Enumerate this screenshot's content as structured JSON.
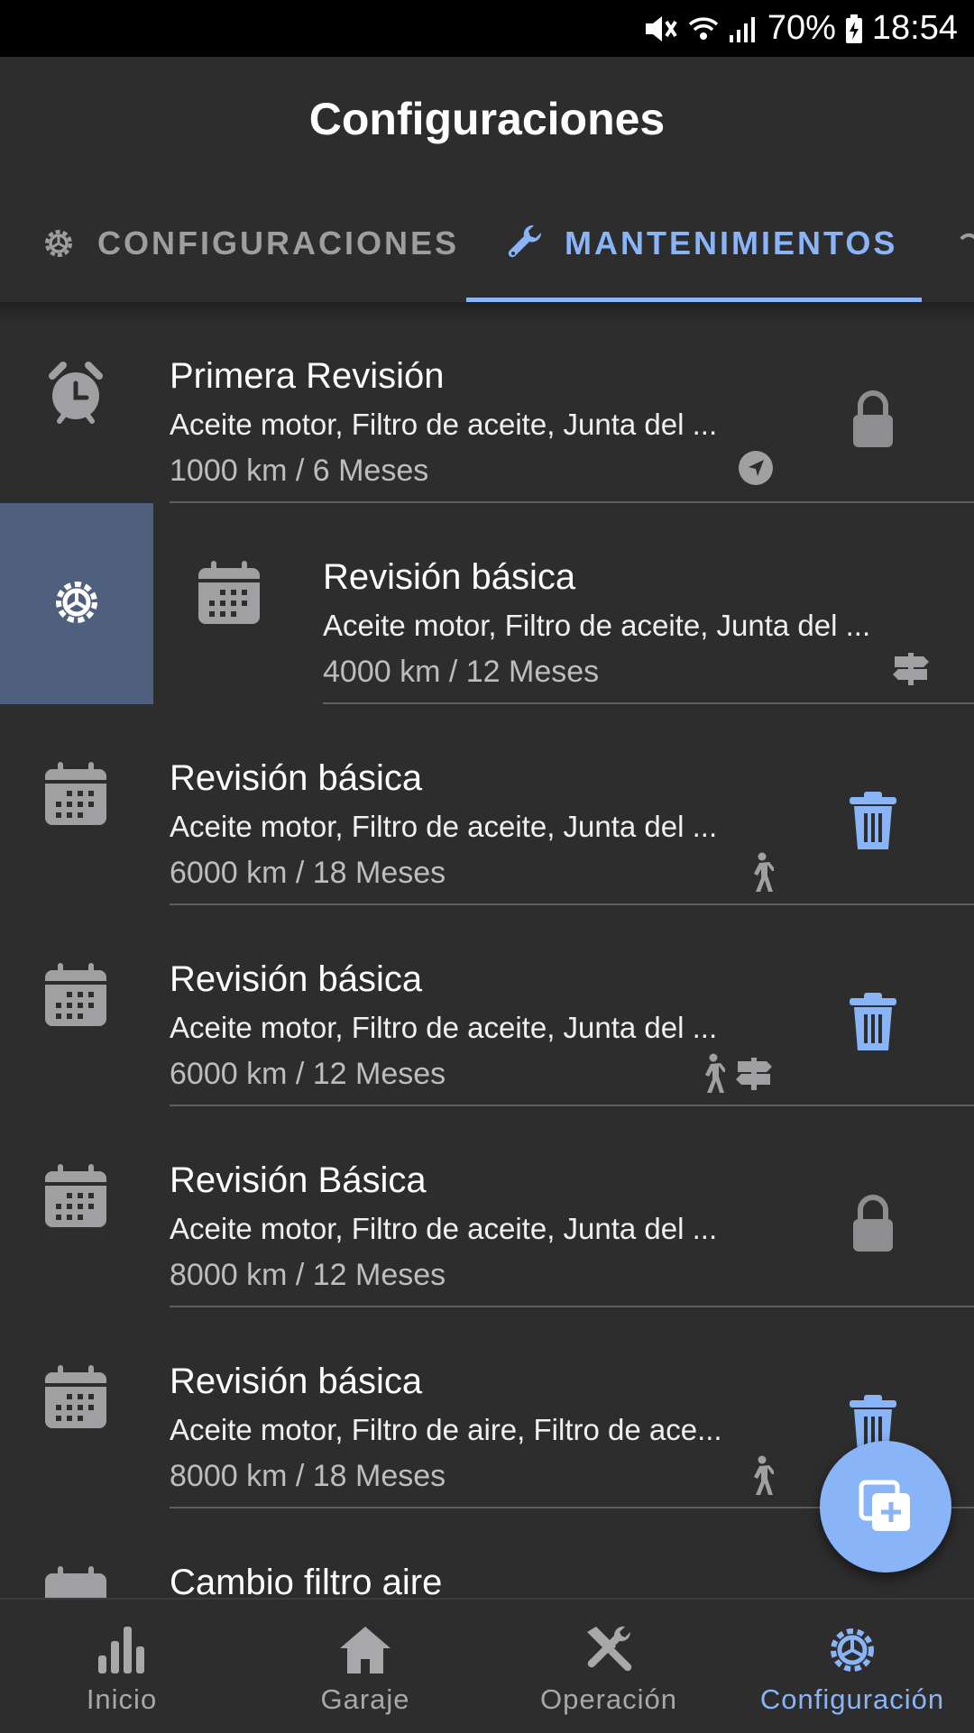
{
  "status_bar": {
    "battery": "70%",
    "time": "18:54"
  },
  "app_bar": {
    "title": "Configuraciones"
  },
  "tabs": [
    {
      "label": "CONFIGURACIONES",
      "icon": "gear-icon",
      "active": false
    },
    {
      "label": "MANTENIMIENTOS",
      "icon": "wrench-icon",
      "active": true
    }
  ],
  "list": [
    {
      "title": "Primera Revisión",
      "subtitle": "Aceite motor, Filtro de aceite, Junta del ...",
      "meta": "1000 km / 6 Meses",
      "lead_icon": "alarm-clock-icon",
      "badges": [
        "navigation-arrow-icon"
      ],
      "trailing_icon": "lock-icon"
    },
    {
      "title": "Revisión básica",
      "subtitle": "Aceite motor, Filtro de aceite, Junta del ...",
      "meta": "4000 km / 12 Meses",
      "lead_icon": "calendar-icon",
      "badges": [
        "signpost-icon"
      ],
      "trailing_icon": "",
      "swipe_action_icon": "gear-icon"
    },
    {
      "title": "Revisión básica",
      "subtitle": "Aceite motor, Filtro de aceite, Junta del ...",
      "meta": "6000 km / 18 Meses",
      "lead_icon": "calendar-icon",
      "badges": [
        "walking-person-icon"
      ],
      "trailing_icon": "trash-icon"
    },
    {
      "title": "Revisión básica",
      "subtitle": "Aceite motor, Filtro de aceite, Junta del ...",
      "meta": "6000 km / 12 Meses",
      "lead_icon": "calendar-icon",
      "badges": [
        "walking-person-icon",
        "signpost-icon"
      ],
      "trailing_icon": "trash-icon"
    },
    {
      "title": "Revisión Básica",
      "subtitle": "Aceite motor, Filtro de aceite, Junta del ...",
      "meta": "8000 km / 12 Meses",
      "lead_icon": "calendar-icon",
      "badges": [],
      "trailing_icon": "lock-icon"
    },
    {
      "title": "Revisión básica",
      "subtitle": "Aceite motor, Filtro de aire, Filtro de ace...",
      "meta": "8000 km / 18 Meses",
      "lead_icon": "calendar-icon",
      "badges": [
        "walking-person-icon"
      ],
      "trailing_icon": "trash-icon"
    },
    {
      "title": "Cambio filtro aire",
      "subtitle": "",
      "meta": "",
      "lead_icon": "calendar-icon",
      "badges": [],
      "trailing_icon": ""
    }
  ],
  "fab": {
    "icon": "add-copy-icon"
  },
  "bottom_nav": [
    {
      "label": "Inicio",
      "icon": "bar-chart-icon",
      "active": false
    },
    {
      "label": "Garaje",
      "icon": "home-icon",
      "active": false
    },
    {
      "label": "Operación",
      "icon": "tools-icon",
      "active": false
    },
    {
      "label": "Configuración",
      "icon": "gear-icon",
      "active": true
    }
  ],
  "colors": {
    "accent": "#8ab4f8",
    "background": "#2d2d2e",
    "swipe_action": "#4e607d",
    "icon_gray": "#a0a0a2"
  }
}
